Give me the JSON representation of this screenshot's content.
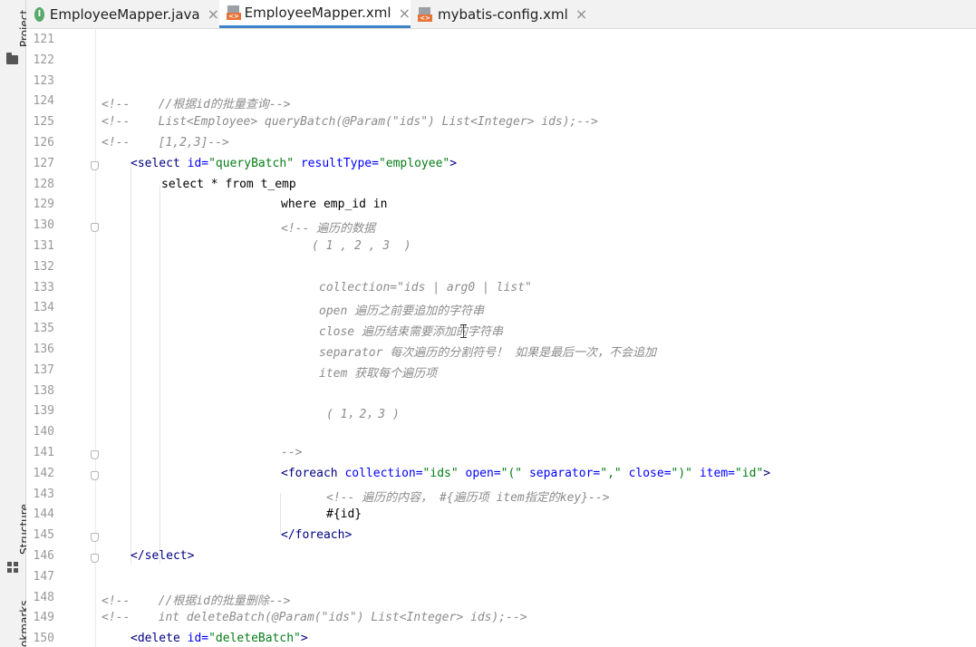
{
  "tool_window": {
    "project_label": "Project",
    "structure_label": "Structure",
    "bookmarks_label": "okmarks"
  },
  "tabs": [
    {
      "label": "EmployeeMapper.java",
      "icon": "java-interface-icon",
      "close": "×",
      "active": false
    },
    {
      "label": "EmployeeMapper.xml",
      "icon": "xml-file-icon",
      "close": "×",
      "active": true
    },
    {
      "label": "mybatis-config.xml",
      "icon": "xml-file-icon",
      "close": "×",
      "active": false
    }
  ],
  "colors": {
    "comment": "#8c8c8c",
    "tag": "#000080",
    "attr_name": "#0000ff",
    "attr_value": "#067d17",
    "active_tab_underline": "#4083c9"
  },
  "lines": [
    {
      "n": "121",
      "t": []
    },
    {
      "n": "122",
      "t": []
    },
    {
      "n": "123",
      "t": []
    },
    {
      "n": "124",
      "t": [
        {
          "c": "cmt",
          "s": "<!--    //根据id的批量查询-->"
        }
      ]
    },
    {
      "n": "125",
      "t": [
        {
          "c": "cmt",
          "s": "<!--    List<Employee> queryBatch(@Param(\"ids\") List<Integer> ids);-->"
        }
      ]
    },
    {
      "n": "126",
      "t": [
        {
          "c": "cmt",
          "s": "<!--    [1,2,3]-->"
        }
      ]
    },
    {
      "n": "127",
      "t": [
        {
          "c": "tg",
          "s": "<select "
        },
        {
          "c": "an",
          "s": "id="
        },
        {
          "c": "av",
          "s": "\"queryBatch\" "
        },
        {
          "c": "an",
          "s": "resultType="
        },
        {
          "c": "av",
          "s": "\"employee\""
        },
        {
          "c": "tg",
          "s": ">"
        }
      ]
    },
    {
      "n": "128",
      "t": [
        {
          "c": "sql",
          "s": "select * from t_emp"
        }
      ]
    },
    {
      "n": "129",
      "t": [
        {
          "c": "sql",
          "s": "where emp_id in"
        }
      ]
    },
    {
      "n": "130",
      "t": [
        {
          "c": "cmt",
          "s": "<!-- 遍历的数据"
        }
      ]
    },
    {
      "n": "131",
      "t": [
        {
          "c": "cmt",
          "s": "( 1 , 2 , 3  )"
        }
      ]
    },
    {
      "n": "132",
      "t": []
    },
    {
      "n": "133",
      "t": [
        {
          "c": "cmt",
          "s": "collection=\"ids | arg0 | list\""
        }
      ]
    },
    {
      "n": "134",
      "t": [
        {
          "c": "cmt",
          "s": "open 遍历之前要追加的字符串"
        }
      ]
    },
    {
      "n": "135",
      "t": [
        {
          "c": "cmt",
          "s": "close 遍历结束需要添加的字符串"
        }
      ]
    },
    {
      "n": "136",
      "t": [
        {
          "c": "cmt",
          "s": "separator 每次遍历的分割符号！ 如果是最后一次，不会追加"
        }
      ]
    },
    {
      "n": "137",
      "t": [
        {
          "c": "cmt",
          "s": "item 获取每个遍历项"
        }
      ]
    },
    {
      "n": "138",
      "t": []
    },
    {
      "n": "139",
      "t": [
        {
          "c": "cmt",
          "s": "( 1，2，3 )"
        }
      ]
    },
    {
      "n": "140",
      "t": []
    },
    {
      "n": "141",
      "t": [
        {
          "c": "cmt",
          "s": "-->"
        }
      ]
    },
    {
      "n": "142",
      "t": [
        {
          "c": "tg",
          "s": "<foreach "
        },
        {
          "c": "an",
          "s": "collection="
        },
        {
          "c": "av",
          "s": "\"ids\" "
        },
        {
          "c": "an",
          "s": "open="
        },
        {
          "c": "av",
          "s": "\"(\" "
        },
        {
          "c": "an",
          "s": "separator="
        },
        {
          "c": "av",
          "s": "\",\" "
        },
        {
          "c": "an",
          "s": "close="
        },
        {
          "c": "av",
          "s": "\")\" "
        },
        {
          "c": "an",
          "s": "item="
        },
        {
          "c": "av",
          "s": "\"id\""
        },
        {
          "c": "tg",
          "s": ">"
        }
      ]
    },
    {
      "n": "143",
      "t": [
        {
          "c": "cmt",
          "s": "<!-- 遍历的内容， #{遍历项 item指定的key}-->"
        }
      ]
    },
    {
      "n": "144",
      "t": [
        {
          "c": "sql",
          "s": "#{id}"
        }
      ]
    },
    {
      "n": "145",
      "t": [
        {
          "c": "tg",
          "s": "</foreach>"
        }
      ]
    },
    {
      "n": "146",
      "t": [
        {
          "c": "tg",
          "s": "</select>"
        }
      ]
    },
    {
      "n": "147",
      "t": []
    },
    {
      "n": "148",
      "t": [
        {
          "c": "cmt",
          "s": "<!--    //根据id的批量删除-->"
        }
      ]
    },
    {
      "n": "149",
      "t": [
        {
          "c": "cmt",
          "s": "<!--    int deleteBatch(@Param(\"ids\") List<Integer> ids);-->"
        }
      ]
    },
    {
      "n": "150",
      "t": [
        {
          "c": "tg",
          "s": "<delete "
        },
        {
          "c": "an",
          "s": "id="
        },
        {
          "c": "av",
          "s": "\"deleteBatch\""
        },
        {
          "c": "tg",
          "s": ">"
        }
      ]
    }
  ]
}
